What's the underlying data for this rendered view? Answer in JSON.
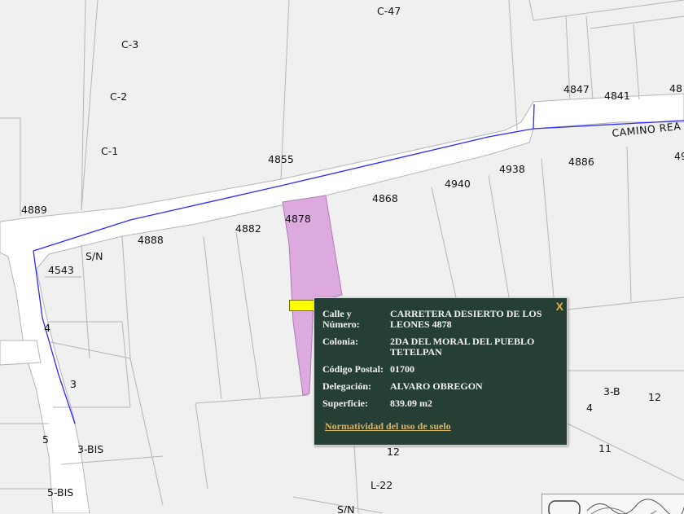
{
  "map": {
    "street_label": "CAMINO REA",
    "lot_labels": [
      "C-47",
      "C-3",
      "C-2",
      "C-1",
      "4855",
      "4847",
      "4841",
      "48",
      "4889",
      "4868",
      "4940",
      "4938",
      "4886",
      "49",
      "4878",
      "4882",
      "4888",
      "S/N",
      "4543",
      "4",
      "3",
      "5",
      "3-BIS",
      "5-BIS",
      "4886",
      "3-B",
      "12",
      "4",
      "11",
      "12",
      "L-22",
      "S/N"
    ]
  },
  "popup": {
    "close_label": "X",
    "fields": [
      {
        "label": "Calle y Número:",
        "value": "CARRETERA DESIERTO DE LOS LEONES 4878"
      },
      {
        "label": "Colonia:",
        "value": "2DA DEL MORAL DEL PUEBLO TETELPAN"
      },
      {
        "label": "Código Postal:",
        "value": "01700"
      },
      {
        "label": "Delegación:",
        "value": "ALVARO OBREGON"
      },
      {
        "label": "Superficie:",
        "value": "839.09 m2"
      }
    ],
    "link_label": "Normatividad del uso de suelo"
  },
  "colors": {
    "popup_bg": "#253f35",
    "selected_parcel": "#dcaadf",
    "street_line": "#1a1aff",
    "pointer": "#ffff00"
  }
}
